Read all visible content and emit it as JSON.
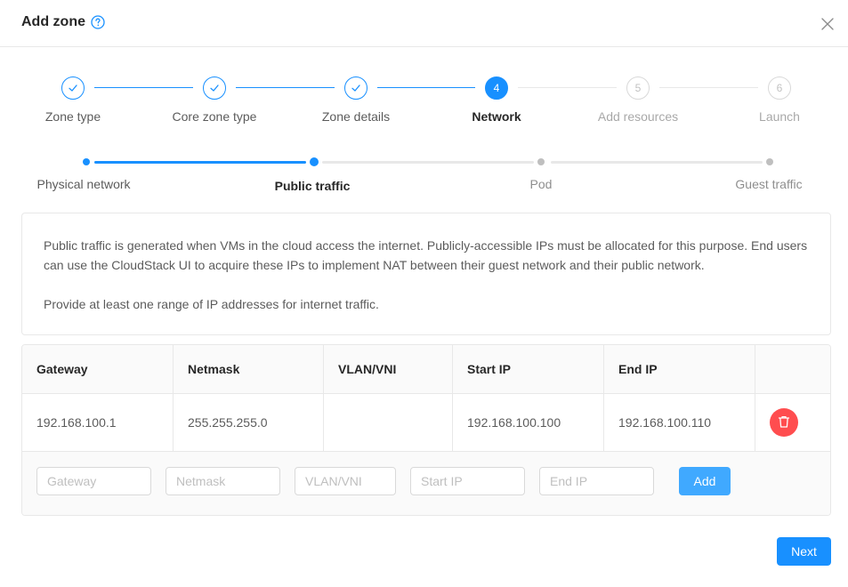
{
  "dialog": {
    "title": "Add zone",
    "help_icon": "question-circle-icon",
    "close_icon": "close-icon"
  },
  "steps": [
    {
      "number": "1",
      "label": "Zone type",
      "status": "done"
    },
    {
      "number": "2",
      "label": "Core zone type",
      "status": "done"
    },
    {
      "number": "3",
      "label": "Zone details",
      "status": "done"
    },
    {
      "number": "4",
      "label": "Network",
      "status": "active"
    },
    {
      "number": "5",
      "label": "Add resources",
      "status": "wait"
    },
    {
      "number": "6",
      "label": "Launch",
      "status": "wait"
    }
  ],
  "substeps": [
    {
      "label": "Physical network",
      "status": "done"
    },
    {
      "label": "Public traffic",
      "status": "active"
    },
    {
      "label": "Pod",
      "status": "wait"
    },
    {
      "label": "Guest traffic",
      "status": "wait"
    }
  ],
  "description": {
    "paragraph1": "Public traffic is generated when VMs in the cloud access the internet. Publicly-accessible IPs must be allocated for this purpose. End users can use the CloudStack UI to acquire these IPs to implement NAT between their guest network and their public network.",
    "paragraph2": "Provide at least one range of IP addresses for internet traffic."
  },
  "table": {
    "columns": [
      "Gateway",
      "Netmask",
      "VLAN/VNI",
      "Start IP",
      "End IP"
    ],
    "rows": [
      {
        "gateway": "192.168.100.1",
        "netmask": "255.255.255.0",
        "vlan": "",
        "start_ip": "192.168.100.100",
        "end_ip": "192.168.100.110"
      }
    ],
    "delete_icon": "trash-icon"
  },
  "form": {
    "gateway_placeholder": "Gateway",
    "netmask_placeholder": "Netmask",
    "vlan_placeholder": "VLAN/VNI",
    "start_ip_placeholder": "Start IP",
    "end_ip_placeholder": "End IP",
    "add_label": "Add"
  },
  "footer": {
    "next_label": "Next"
  },
  "colors": {
    "primary": "#1890ff",
    "danger": "#ff4d4f",
    "add_button": "#40a9ff"
  }
}
